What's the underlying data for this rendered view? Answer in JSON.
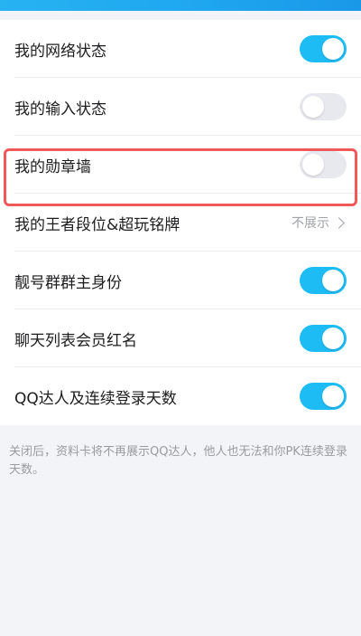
{
  "settings": [
    {
      "label": "我的网络状态",
      "toggle": "on"
    },
    {
      "label": "我的输入状态",
      "toggle": "off"
    },
    {
      "label": "我的勋章墙",
      "toggle": "off"
    },
    {
      "label": "我的王者段位&超玩铭牌",
      "value": "不展示"
    },
    {
      "label": "靓号群群主身份",
      "toggle": "on"
    },
    {
      "label": "聊天列表会员红名",
      "toggle": "on"
    },
    {
      "label": "QQ达人及连续登录天数",
      "toggle": "on"
    }
  ],
  "footnote": "关闭后，资料卡将不再展示QQ达人，他人也无法和你PK连续登录天数。",
  "colors": {
    "accent": "#1ebcf5",
    "highlight_border": "#ee5a5a"
  },
  "icons": {
    "chevron": "chevron-right-icon"
  }
}
